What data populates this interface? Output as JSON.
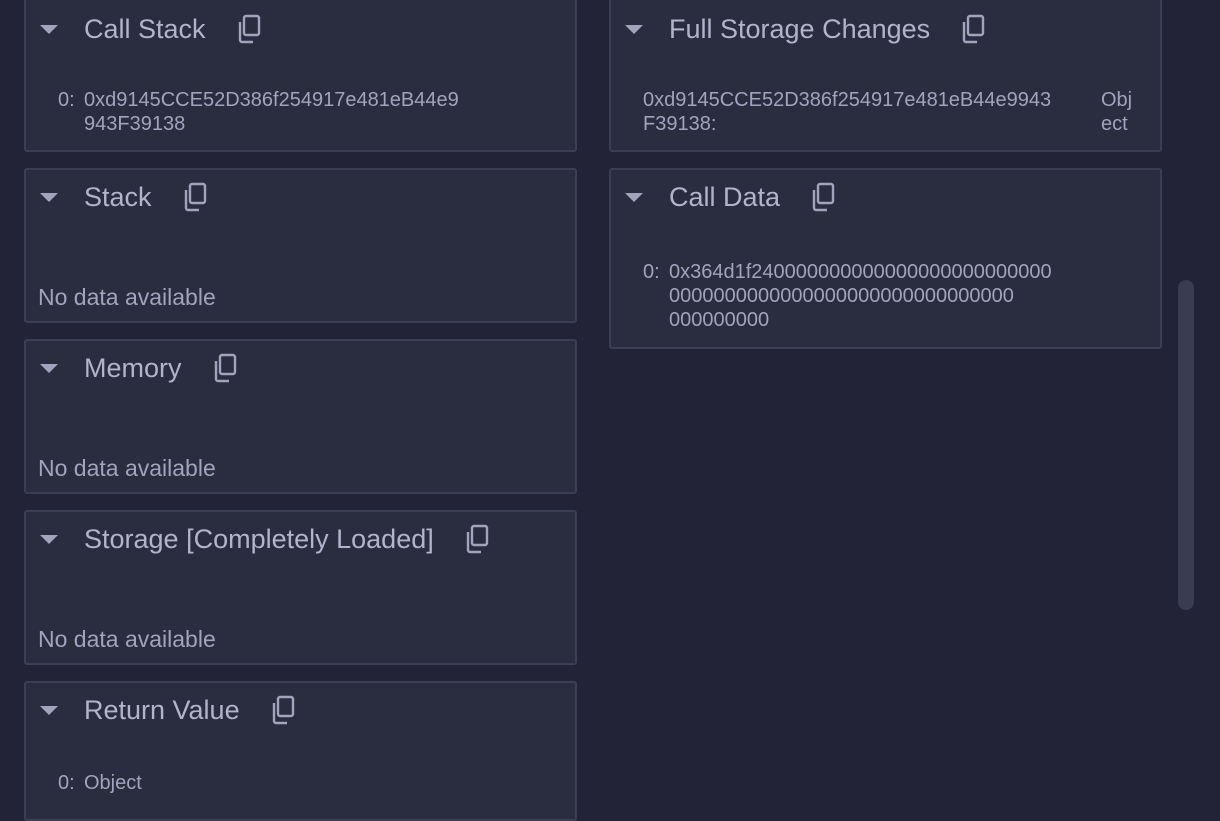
{
  "left": {
    "call_stack": {
      "title": "Call Stack",
      "index": "0:",
      "line1": "0xd9145CCE52D386f254917e481eB44e9",
      "line2": "943F39138"
    },
    "stack": {
      "title": "Stack",
      "empty": "No data available"
    },
    "memory": {
      "title": "Memory",
      "empty": "No data available"
    },
    "storage": {
      "title": "Storage [Completely Loaded]",
      "empty": "No data available"
    },
    "return_value": {
      "title": "Return Value",
      "index": "0:",
      "value": "Object"
    }
  },
  "right": {
    "full_storage": {
      "title": "Full Storage Changes",
      "key1": "0xd9145CCE52D386f254917e481eB44e9943",
      "key2": "F39138:",
      "val1": "Obj",
      "val2": "ect"
    },
    "call_data": {
      "title": "Call Data",
      "index": "0:",
      "line1": "0x364d1f240000000000000000000000000",
      "line2": "0000000000000000000000000000000",
      "line3": "000000000"
    }
  },
  "icons": {
    "caret": "caret-down-icon",
    "copy": "copy-icon"
  },
  "colors": {
    "background": "#222336",
    "card": "#2a2c3f",
    "border": "#3c3e54",
    "text": "#a2a3bd"
  }
}
